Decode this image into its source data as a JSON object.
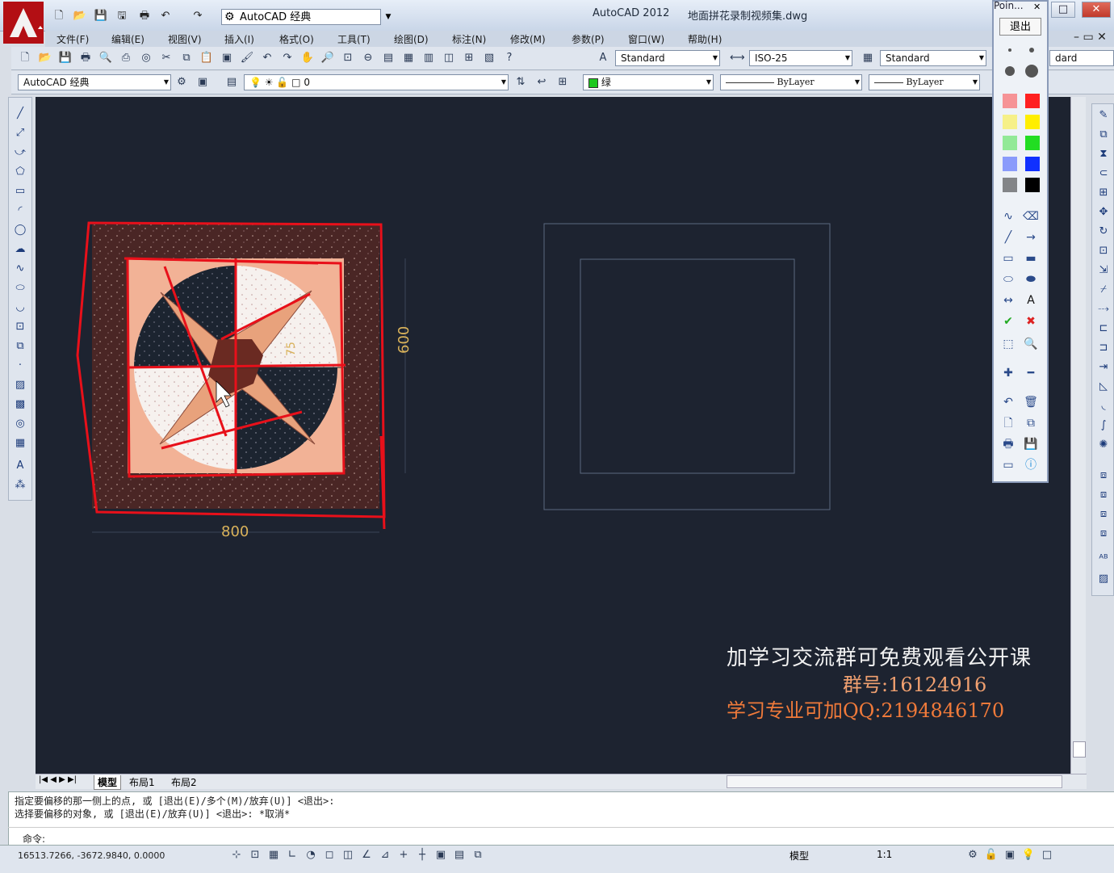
{
  "titlebar": {
    "workspace": "AutoCAD 经典",
    "app_title": "AutoCAD 2012",
    "file_title": "地面拼花录制视频集.dwg",
    "min_label": "▭",
    "max_label": "□",
    "close_label": "✕"
  },
  "menu": [
    "文件(F)",
    "编辑(E)",
    "视图(V)",
    "插入(I)",
    "格式(O)",
    "工具(T)",
    "绘图(D)",
    "标注(N)",
    "修改(M)",
    "参数(P)",
    "窗口(W)",
    "帮助(H)"
  ],
  "toolbar": {
    "text_style": "Standard",
    "dim_style": "ISO-25",
    "table_style": "Standard",
    "mleader_style": "dard"
  },
  "layers": {
    "workspace": "AutoCAD 经典",
    "layer_name": "0",
    "color": "绿",
    "linetype": "ByLayer",
    "lineweight": "ByLayer"
  },
  "drawing": {
    "dim_width": "800",
    "dim_height": "600",
    "dim_small": "75"
  },
  "overlay": {
    "line1": "加学习交流群可免费观看公开课",
    "line2": "群号:16124916",
    "line3": "学习专业可加QQ:2194846170"
  },
  "tabs": [
    "模型",
    "布局1",
    "布局2"
  ],
  "command": {
    "line1": "指定要偏移的那一侧上的点, 或 [退出(E)/多个(M)/放弃(U)] <退出>:",
    "line2": "选择要偏移的对象, 或 [退出(E)/放弃(U)] <退出>:  *取消*",
    "prompt": "命令:"
  },
  "status": {
    "coords": "16513.7266,  -3672.9840,  0.0000",
    "model_label": "模型",
    "scale": "1:1"
  },
  "point_panel": {
    "title": "Poin...",
    "exit": "退出",
    "colors": [
      "#ff2020",
      "#ffee00",
      "#22dd22",
      "#1030ff",
      "#000000"
    ]
  },
  "colors": {
    "canvas": "#1d2330",
    "markup_red": "#e8101a",
    "dim_text": "#d9b25a"
  }
}
